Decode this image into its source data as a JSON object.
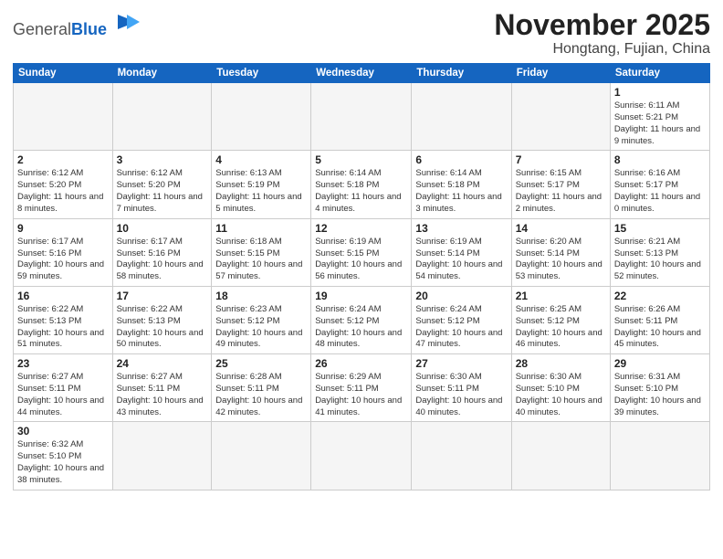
{
  "logo": {
    "general": "General",
    "blue": "Blue"
  },
  "title": "November 2025",
  "location": "Hongtang, Fujian, China",
  "days_of_week": [
    "Sunday",
    "Monday",
    "Tuesday",
    "Wednesday",
    "Thursday",
    "Friday",
    "Saturday"
  ],
  "weeks": [
    [
      {
        "day": "",
        "info": ""
      },
      {
        "day": "",
        "info": ""
      },
      {
        "day": "",
        "info": ""
      },
      {
        "day": "",
        "info": ""
      },
      {
        "day": "",
        "info": ""
      },
      {
        "day": "",
        "info": ""
      },
      {
        "day": "1",
        "info": "Sunrise: 6:11 AM\nSunset: 5:21 PM\nDaylight: 11 hours and 9 minutes."
      }
    ],
    [
      {
        "day": "2",
        "info": "Sunrise: 6:12 AM\nSunset: 5:20 PM\nDaylight: 11 hours and 8 minutes."
      },
      {
        "day": "3",
        "info": "Sunrise: 6:12 AM\nSunset: 5:20 PM\nDaylight: 11 hours and 7 minutes."
      },
      {
        "day": "4",
        "info": "Sunrise: 6:13 AM\nSunset: 5:19 PM\nDaylight: 11 hours and 5 minutes."
      },
      {
        "day": "5",
        "info": "Sunrise: 6:14 AM\nSunset: 5:18 PM\nDaylight: 11 hours and 4 minutes."
      },
      {
        "day": "6",
        "info": "Sunrise: 6:14 AM\nSunset: 5:18 PM\nDaylight: 11 hours and 3 minutes."
      },
      {
        "day": "7",
        "info": "Sunrise: 6:15 AM\nSunset: 5:17 PM\nDaylight: 11 hours and 2 minutes."
      },
      {
        "day": "8",
        "info": "Sunrise: 6:16 AM\nSunset: 5:17 PM\nDaylight: 11 hours and 0 minutes."
      }
    ],
    [
      {
        "day": "9",
        "info": "Sunrise: 6:17 AM\nSunset: 5:16 PM\nDaylight: 10 hours and 59 minutes."
      },
      {
        "day": "10",
        "info": "Sunrise: 6:17 AM\nSunset: 5:16 PM\nDaylight: 10 hours and 58 minutes."
      },
      {
        "day": "11",
        "info": "Sunrise: 6:18 AM\nSunset: 5:15 PM\nDaylight: 10 hours and 57 minutes."
      },
      {
        "day": "12",
        "info": "Sunrise: 6:19 AM\nSunset: 5:15 PM\nDaylight: 10 hours and 56 minutes."
      },
      {
        "day": "13",
        "info": "Sunrise: 6:19 AM\nSunset: 5:14 PM\nDaylight: 10 hours and 54 minutes."
      },
      {
        "day": "14",
        "info": "Sunrise: 6:20 AM\nSunset: 5:14 PM\nDaylight: 10 hours and 53 minutes."
      },
      {
        "day": "15",
        "info": "Sunrise: 6:21 AM\nSunset: 5:13 PM\nDaylight: 10 hours and 52 minutes."
      }
    ],
    [
      {
        "day": "16",
        "info": "Sunrise: 6:22 AM\nSunset: 5:13 PM\nDaylight: 10 hours and 51 minutes."
      },
      {
        "day": "17",
        "info": "Sunrise: 6:22 AM\nSunset: 5:13 PM\nDaylight: 10 hours and 50 minutes."
      },
      {
        "day": "18",
        "info": "Sunrise: 6:23 AM\nSunset: 5:12 PM\nDaylight: 10 hours and 49 minutes."
      },
      {
        "day": "19",
        "info": "Sunrise: 6:24 AM\nSunset: 5:12 PM\nDaylight: 10 hours and 48 minutes."
      },
      {
        "day": "20",
        "info": "Sunrise: 6:24 AM\nSunset: 5:12 PM\nDaylight: 10 hours and 47 minutes."
      },
      {
        "day": "21",
        "info": "Sunrise: 6:25 AM\nSunset: 5:12 PM\nDaylight: 10 hours and 46 minutes."
      },
      {
        "day": "22",
        "info": "Sunrise: 6:26 AM\nSunset: 5:11 PM\nDaylight: 10 hours and 45 minutes."
      }
    ],
    [
      {
        "day": "23",
        "info": "Sunrise: 6:27 AM\nSunset: 5:11 PM\nDaylight: 10 hours and 44 minutes."
      },
      {
        "day": "24",
        "info": "Sunrise: 6:27 AM\nSunset: 5:11 PM\nDaylight: 10 hours and 43 minutes."
      },
      {
        "day": "25",
        "info": "Sunrise: 6:28 AM\nSunset: 5:11 PM\nDaylight: 10 hours and 42 minutes."
      },
      {
        "day": "26",
        "info": "Sunrise: 6:29 AM\nSunset: 5:11 PM\nDaylight: 10 hours and 41 minutes."
      },
      {
        "day": "27",
        "info": "Sunrise: 6:30 AM\nSunset: 5:11 PM\nDaylight: 10 hours and 40 minutes."
      },
      {
        "day": "28",
        "info": "Sunrise: 6:30 AM\nSunset: 5:10 PM\nDaylight: 10 hours and 40 minutes."
      },
      {
        "day": "29",
        "info": "Sunrise: 6:31 AM\nSunset: 5:10 PM\nDaylight: 10 hours and 39 minutes."
      }
    ],
    [
      {
        "day": "30",
        "info": "Sunrise: 6:32 AM\nSunset: 5:10 PM\nDaylight: 10 hours and 38 minutes."
      },
      {
        "day": "",
        "info": ""
      },
      {
        "day": "",
        "info": ""
      },
      {
        "day": "",
        "info": ""
      },
      {
        "day": "",
        "info": ""
      },
      {
        "day": "",
        "info": ""
      },
      {
        "day": "",
        "info": ""
      }
    ]
  ]
}
